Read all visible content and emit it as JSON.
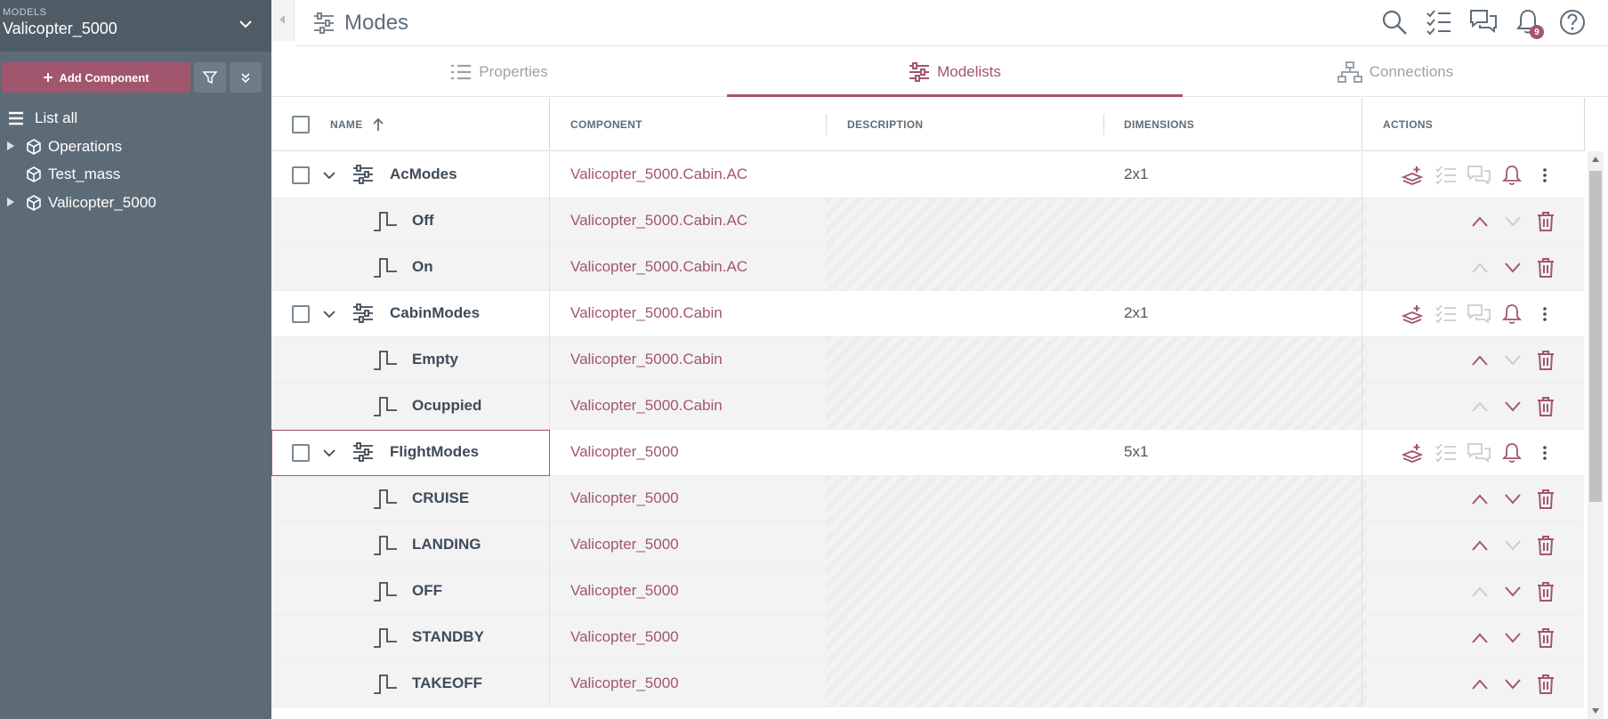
{
  "sidebar": {
    "models_caption": "MODELS",
    "model_name": "Valicopter_5000",
    "add_component_label": "Add Component",
    "tree": [
      {
        "label": "List all",
        "icon": "list-icon",
        "expandable": false
      },
      {
        "label": "Operations",
        "icon": "cube-icon",
        "expandable": true
      },
      {
        "label": "Test_mass",
        "icon": "cube-icon",
        "expandable": false
      },
      {
        "label": "Valicopter_5000",
        "icon": "cube-icon",
        "expandable": true
      }
    ]
  },
  "header": {
    "title": "Modes",
    "notification_count": "9"
  },
  "tabs": [
    {
      "label": "Properties",
      "active": false
    },
    {
      "label": "Modelists",
      "active": true
    },
    {
      "label": "Connections",
      "active": false
    }
  ],
  "table": {
    "columns": {
      "name": "NAME",
      "component": "COMPONENT",
      "description": "DESCRIPTION",
      "dimensions": "DIMENSIONS",
      "actions": "ACTIONS"
    },
    "rows": [
      {
        "type": "group",
        "name": "AcModes",
        "component": "Valicopter_5000.Cabin.AC",
        "dimensions": "2x1"
      },
      {
        "type": "child",
        "name": "Off",
        "component": "Valicopter_5000.Cabin.AC",
        "up": true,
        "down": false
      },
      {
        "type": "child",
        "name": "On",
        "component": "Valicopter_5000.Cabin.AC",
        "up": false,
        "down": true
      },
      {
        "type": "group",
        "name": "CabinModes",
        "component": "Valicopter_5000.Cabin",
        "dimensions": "2x1"
      },
      {
        "type": "child",
        "name": "Empty",
        "component": "Valicopter_5000.Cabin",
        "up": true,
        "down": false
      },
      {
        "type": "child",
        "name": "Ocuppied",
        "component": "Valicopter_5000.Cabin",
        "up": false,
        "down": true
      },
      {
        "type": "group",
        "name": "FlightModes",
        "component": "Valicopter_5000",
        "dimensions": "5x1",
        "selected": true
      },
      {
        "type": "child",
        "name": "CRUISE",
        "component": "Valicopter_5000",
        "up": true,
        "down": true
      },
      {
        "type": "child",
        "name": "LANDING",
        "component": "Valicopter_5000",
        "up": true,
        "down": false
      },
      {
        "type": "child",
        "name": "OFF",
        "component": "Valicopter_5000",
        "up": false,
        "down": true
      },
      {
        "type": "child",
        "name": "STANDBY",
        "component": "Valicopter_5000",
        "up": true,
        "down": true
      },
      {
        "type": "child",
        "name": "TAKEOFF",
        "component": "Valicopter_5000",
        "up": true,
        "down": true
      }
    ]
  },
  "colors": {
    "accent": "#a2566d",
    "sidebar": "#5d6b76",
    "disabled": "#c9cdd1"
  }
}
